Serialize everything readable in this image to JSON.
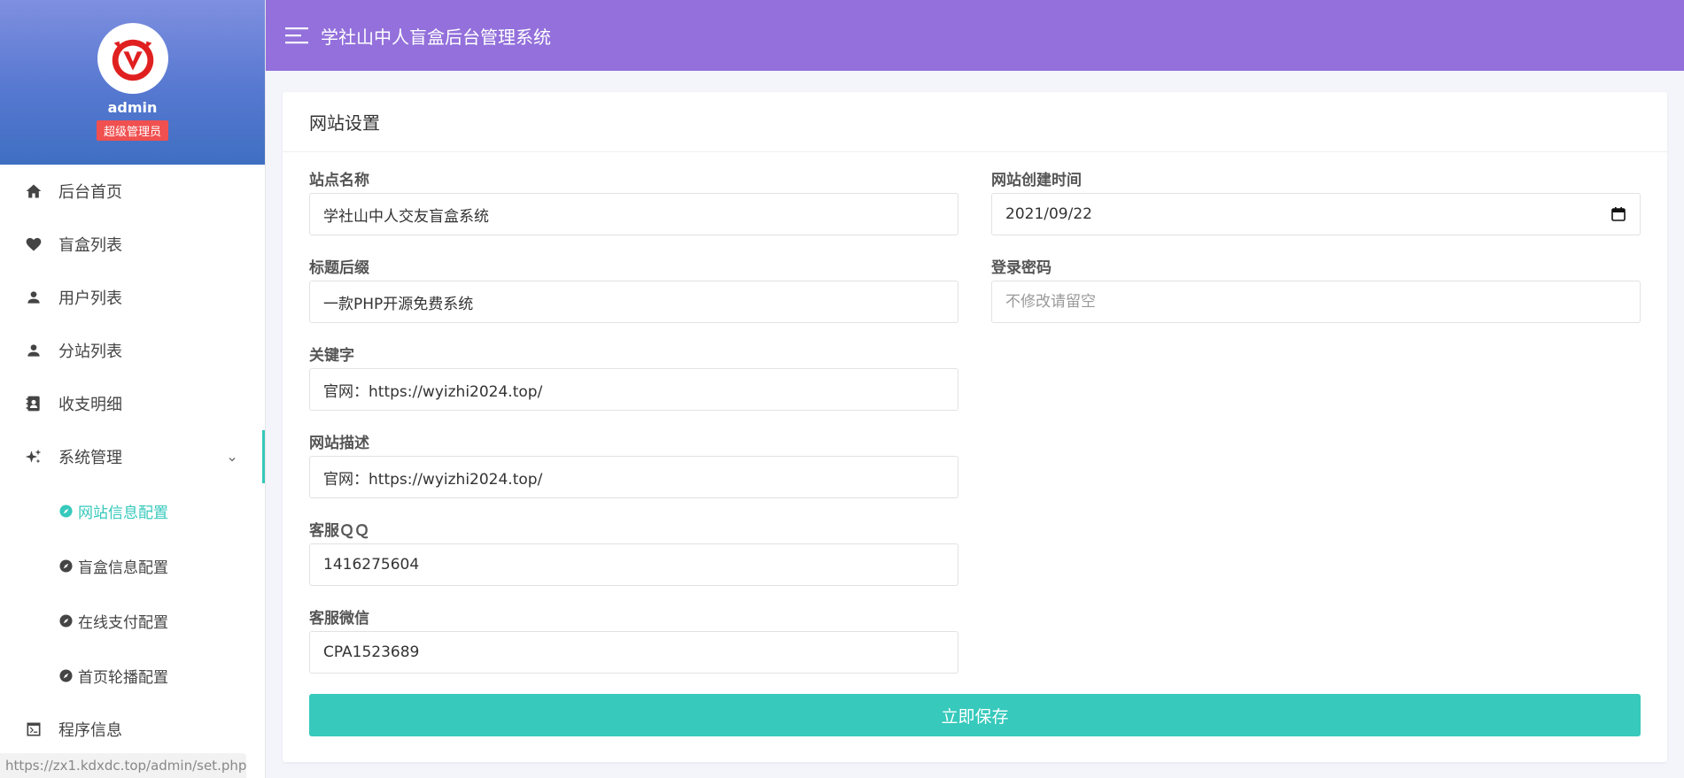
{
  "app": {
    "title": "学社山中人盲盒后台管理系统"
  },
  "profile": {
    "name": "admin",
    "role": "超级管理员"
  },
  "sidebar": {
    "items": [
      {
        "label": "后台首页",
        "icon": "home-icon"
      },
      {
        "label": "盲盒列表",
        "icon": "heart-icon"
      },
      {
        "label": "用户列表",
        "icon": "user-icon"
      },
      {
        "label": "分站列表",
        "icon": "user-icon"
      },
      {
        "label": "收支明细",
        "icon": "contact-book-icon"
      },
      {
        "label": "系统管理",
        "icon": "sparkle-icon",
        "expanded": true
      },
      {
        "label": "程序信息",
        "icon": "terminal-icon"
      }
    ],
    "sub_items": [
      {
        "label": "网站信息配置",
        "active": true
      },
      {
        "label": "盲盒信息配置"
      },
      {
        "label": "在线支付配置"
      },
      {
        "label": "首页轮播配置"
      }
    ]
  },
  "card": {
    "title": "网站设置"
  },
  "form": {
    "site_name": {
      "label": "站点名称",
      "value": "学社山中人交友盲盒系统"
    },
    "title_suffix": {
      "label": "标题后缀",
      "value": "一款PHP开源免费系统"
    },
    "keywords": {
      "label": "关键字",
      "value": "官网：https://wyizhi2024.top/"
    },
    "description": {
      "label": "网站描述",
      "value": "官网：https://wyizhi2024.top/"
    },
    "service_qq": {
      "label": "客服ＱＱ",
      "value": "1416275604"
    },
    "service_wechat": {
      "label": "客服微信",
      "value": "CPA1523689"
    },
    "created_date": {
      "label": "网站创建时间",
      "value": "2021/09/22"
    },
    "login_password": {
      "label": "登录密码",
      "placeholder": "不修改请留空"
    },
    "save_label": "立即保存"
  },
  "status_bar": {
    "url": "https://zx1.kdxdc.top/admin/set.php"
  },
  "colors": {
    "header": "#9370db",
    "accent": "#36c9bc",
    "badge": "#f05050"
  }
}
